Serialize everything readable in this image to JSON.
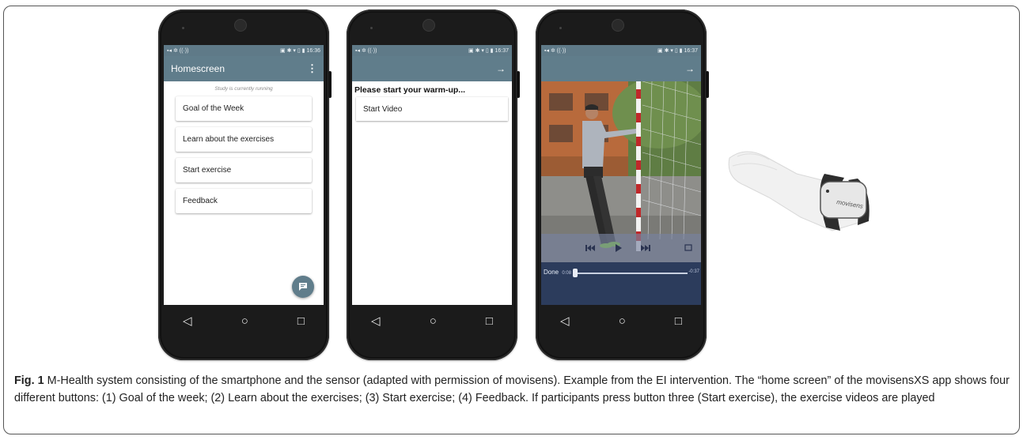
{
  "phone1": {
    "status_time": "16:36",
    "app_title": "Homescreen",
    "study_status": "Study is currently running",
    "buttons": [
      "Goal of the Week",
      "Learn about the exercises",
      "Start exercise",
      "Feedback"
    ]
  },
  "phone2": {
    "status_time": "16:37",
    "prompt": "Please start your warm-up...",
    "start_video_label": "Start Video"
  },
  "phone3": {
    "status_time": "16:37",
    "done_label": "Done",
    "elapsed": "0:08",
    "remaining": "-0:37"
  },
  "sensor_brand": "movisens",
  "caption": {
    "label": "Fig. 1",
    "text": "M-Health system consisting of the smartphone and the sensor (adapted with permission of movisens). Example from the EI intervention. The “home screen” of the movisensXS app shows four different buttons: (1) Goal of the week; (2) Learn about the exercises; (3) Start exercise; (4) Feedback. If participants press button three (Start exercise), the exercise videos are played"
  },
  "colors": {
    "appbar": "#607d8b",
    "statusbar": "#5f7a88",
    "phone_body": "#1b1b1b"
  },
  "icons": {
    "forward": "arrow-right-icon",
    "overflow": "more-vert-icon",
    "fab": "chat-icon",
    "nav": [
      "back-icon",
      "home-icon",
      "recents-icon"
    ],
    "player": [
      "skip-previous-icon",
      "play-icon",
      "skip-next-icon"
    ]
  }
}
